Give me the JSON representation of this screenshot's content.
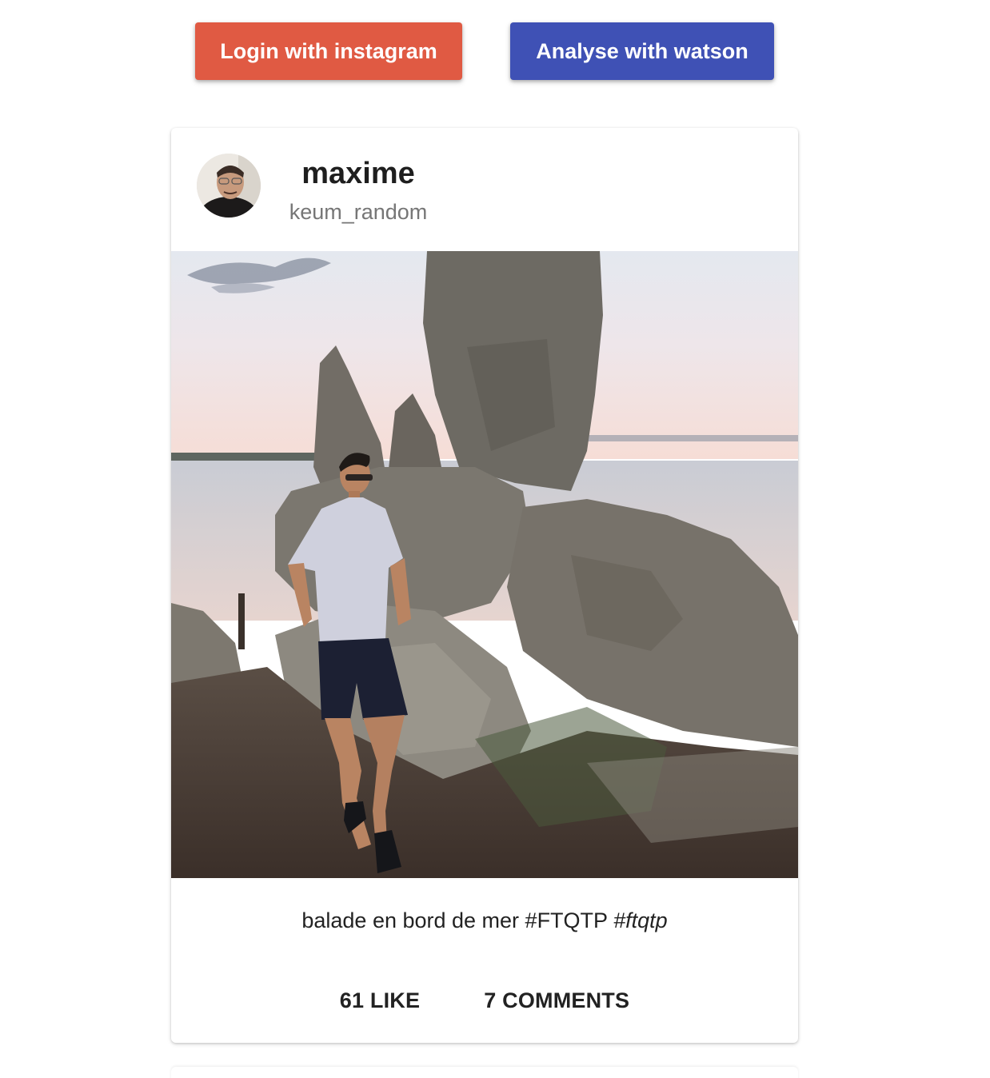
{
  "toolbar": {
    "login_label": "Login with instagram",
    "analyse_label": "Analyse with watson",
    "login_color": "#e05a43",
    "analyse_color": "#3f51b5"
  },
  "post": {
    "name": "maxime",
    "username": "keum_random",
    "caption_text": "balade en bord de mer #FTQTP ",
    "caption_italic": "#ftqtp",
    "likes_label": "61 LIKE",
    "comments_label": "7 COMMENTS"
  }
}
